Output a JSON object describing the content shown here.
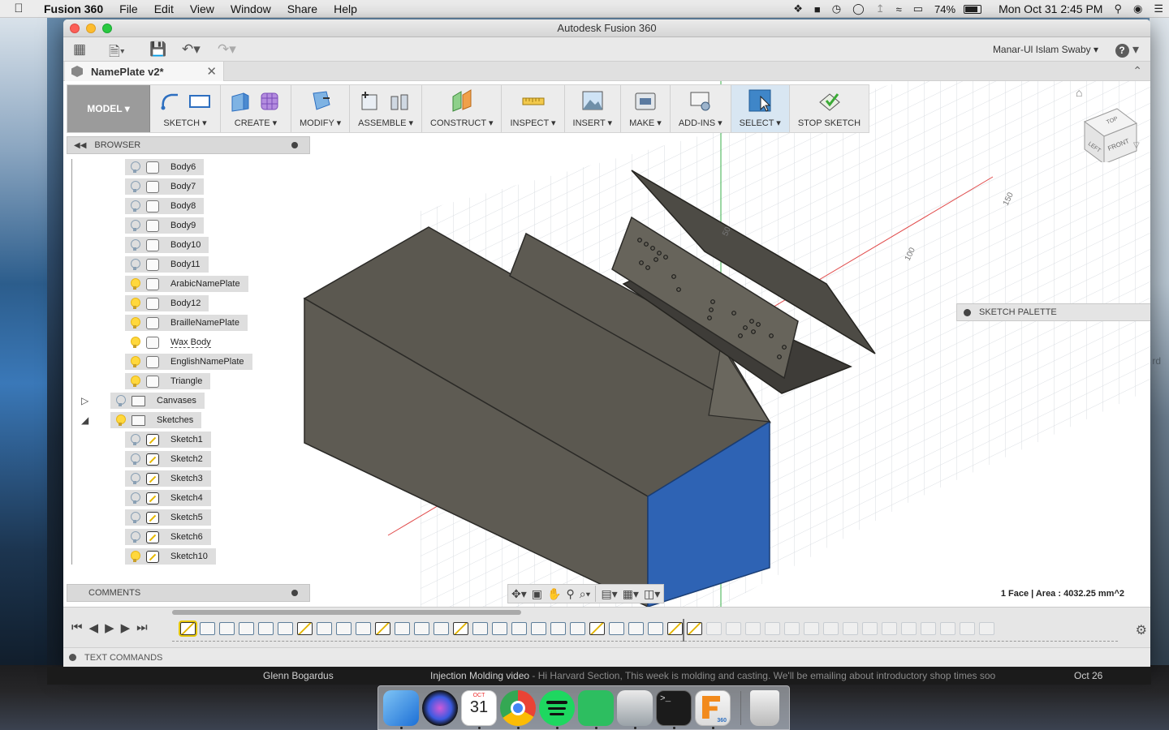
{
  "menubar": {
    "app": "Fusion 360",
    "items": [
      "File",
      "Edit",
      "View",
      "Window",
      "Share",
      "Help"
    ],
    "battery": "74%",
    "clock": "Mon Oct 31  2:45 PM"
  },
  "window": {
    "title": "Autodesk Fusion 360",
    "user": "Manar-Ul Islam Swaby ▾",
    "doc_tab": "NamePlate v2*"
  },
  "toolbar": {
    "mode": "MODEL ▾",
    "groups": [
      "SKETCH ▾",
      "CREATE ▾",
      "MODIFY ▾",
      "ASSEMBLE ▾",
      "CONSTRUCT ▾",
      "INSPECT ▾",
      "INSERT ▾",
      "MAKE ▾",
      "ADD-INS ▾",
      "SELECT ▾",
      "STOP SKETCH"
    ]
  },
  "browser": {
    "title": "BROWSER",
    "items": [
      {
        "label": "Body6",
        "on": false
      },
      {
        "label": "Body7",
        "on": false
      },
      {
        "label": "Body8",
        "on": false
      },
      {
        "label": "Body9",
        "on": false
      },
      {
        "label": "Body10",
        "on": false
      },
      {
        "label": "Body11",
        "on": false
      },
      {
        "label": "ArabicNamePlate",
        "on": true
      },
      {
        "label": "Body12",
        "on": true
      },
      {
        "label": "BrailleNamePlate",
        "on": true
      },
      {
        "label": "Wax Body",
        "on": true
      },
      {
        "label": "EnglishNamePlate",
        "on": true
      },
      {
        "label": "Triangle",
        "on": true
      },
      {
        "label": "Canvases",
        "on": false
      },
      {
        "label": "Sketches",
        "on": true
      },
      {
        "label": "Sketch1",
        "on": false
      },
      {
        "label": "Sketch2",
        "on": false
      },
      {
        "label": "Sketch3",
        "on": false
      },
      {
        "label": "Sketch4",
        "on": false
      },
      {
        "label": "Sketch5",
        "on": false
      },
      {
        "label": "Sketch6",
        "on": false
      },
      {
        "label": "Sketch10",
        "on": true
      }
    ]
  },
  "comments": "COMMENTS",
  "sketch_palette": "SKETCH PALETTE",
  "status": "1 Face | Area : 4032.25 mm^2",
  "viewcube": {
    "top": "TOP",
    "left": "LEFT",
    "front": "FRONT"
  },
  "dims": [
    "50",
    "100",
    "150"
  ],
  "text_commands": "TEXT COMMANDS",
  "mail": {
    "sender": "Glenn Bogardus",
    "subject": "Injection Molding video",
    "preview": " - Hi Harvard Section, This week is molding and casting. We'll be emailing about introductory shop times soo",
    "date": "Oct 26"
  },
  "dock": {
    "calendar_month": "OCT",
    "calendar_day": "31",
    "fusion_badge": "360"
  },
  "desk_text": "rd"
}
